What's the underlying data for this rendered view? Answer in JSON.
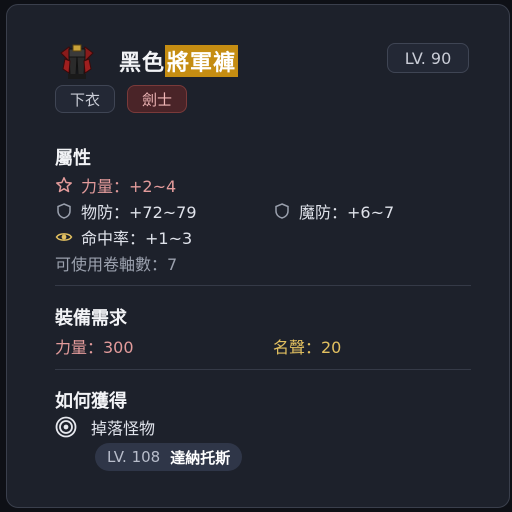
{
  "item": {
    "name_prefix": "黑色",
    "name_highlight": "將軍褲",
    "level": "LV. 90",
    "icon": "pants-icon",
    "tags": {
      "type": "下衣",
      "job": "劍士"
    }
  },
  "attributes": {
    "title": "屬性",
    "str": "力量：+2~4",
    "wdef": "物防：+72~79",
    "mdef": "魔防：+6~7",
    "accuracy": "命中率：+1~3",
    "scrolls": "可使用卷軸數：7"
  },
  "requirements": {
    "title": "裝備需求",
    "str": "力量：300",
    "fame": "名聲：20"
  },
  "obtain": {
    "title": "如何獲得",
    "method": "掉落怪物",
    "monster_level": "LV. 108",
    "monster_name": "達納托斯"
  },
  "colors": {
    "highlight": "#c58d12",
    "card_bg": "#1d212b",
    "requirement_red": "#e39b9b",
    "requirement_gold": "#e2c060"
  }
}
